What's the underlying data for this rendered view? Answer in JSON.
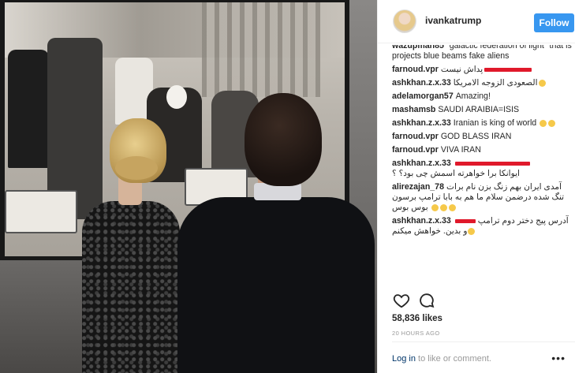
{
  "post": {
    "photo_alt": "Photo of two people viewing a historic black-and-white photograph in a gallery"
  },
  "header": {
    "username": "ivankatrump",
    "follow_label": "Follow",
    "avatar_icon": "profile-avatar"
  },
  "comments": [
    {
      "user": "wazupman85",
      "text": "\"galactic federation of light\" that is projects blue beams fake aliens"
    },
    {
      "user": "farnoud.vpr",
      "text": "پداش نیست",
      "redacted": true
    },
    {
      "user": "ashkhan.z.x.33",
      "text": "الصعودی الزوجه الامریکا"
    },
    {
      "user": "adelamorgan57",
      "text": "Amazing!"
    },
    {
      "user": "mashamsb",
      "text": "SAUDI ARAIBIA=ISIS"
    },
    {
      "user": "ashkhan.z.x.33",
      "text": "Iranian is king of world"
    },
    {
      "user": "farnoud.vpr",
      "text": "GOD BLASS IRAN"
    },
    {
      "user": "farnoud.vpr",
      "text": "VIVA IRAN"
    },
    {
      "user": "ashkhan.z.x.33",
      "text": "ایوانکا برا خواهرته اسمش چی بود؟ ؟",
      "redacted": true
    },
    {
      "user": "alirezajan_78",
      "text": "آمدی ایران بهم زنگ بزن نام برات تنگ شده درضمن سلام ما هم به بابا ترامپ برسون بوس بوس"
    },
    {
      "user": "ashkhan.z.x.33",
      "text": "آدرس پیج دختر دوم ترامپ و بدین. خواهش میکنم",
      "redacted": true
    }
  ],
  "actions": {
    "like_icon": "heart-icon",
    "comment_icon": "comment-icon"
  },
  "likes": "58,836 likes",
  "timestamp": "20 HOURS AGO",
  "footer": {
    "login_link": "Log in",
    "login_rest": " to like or comment.",
    "more_icon": "ellipsis-icon"
  },
  "colors": {
    "follow_button": "#3897f0",
    "link": "#003569",
    "muted": "#999999"
  }
}
